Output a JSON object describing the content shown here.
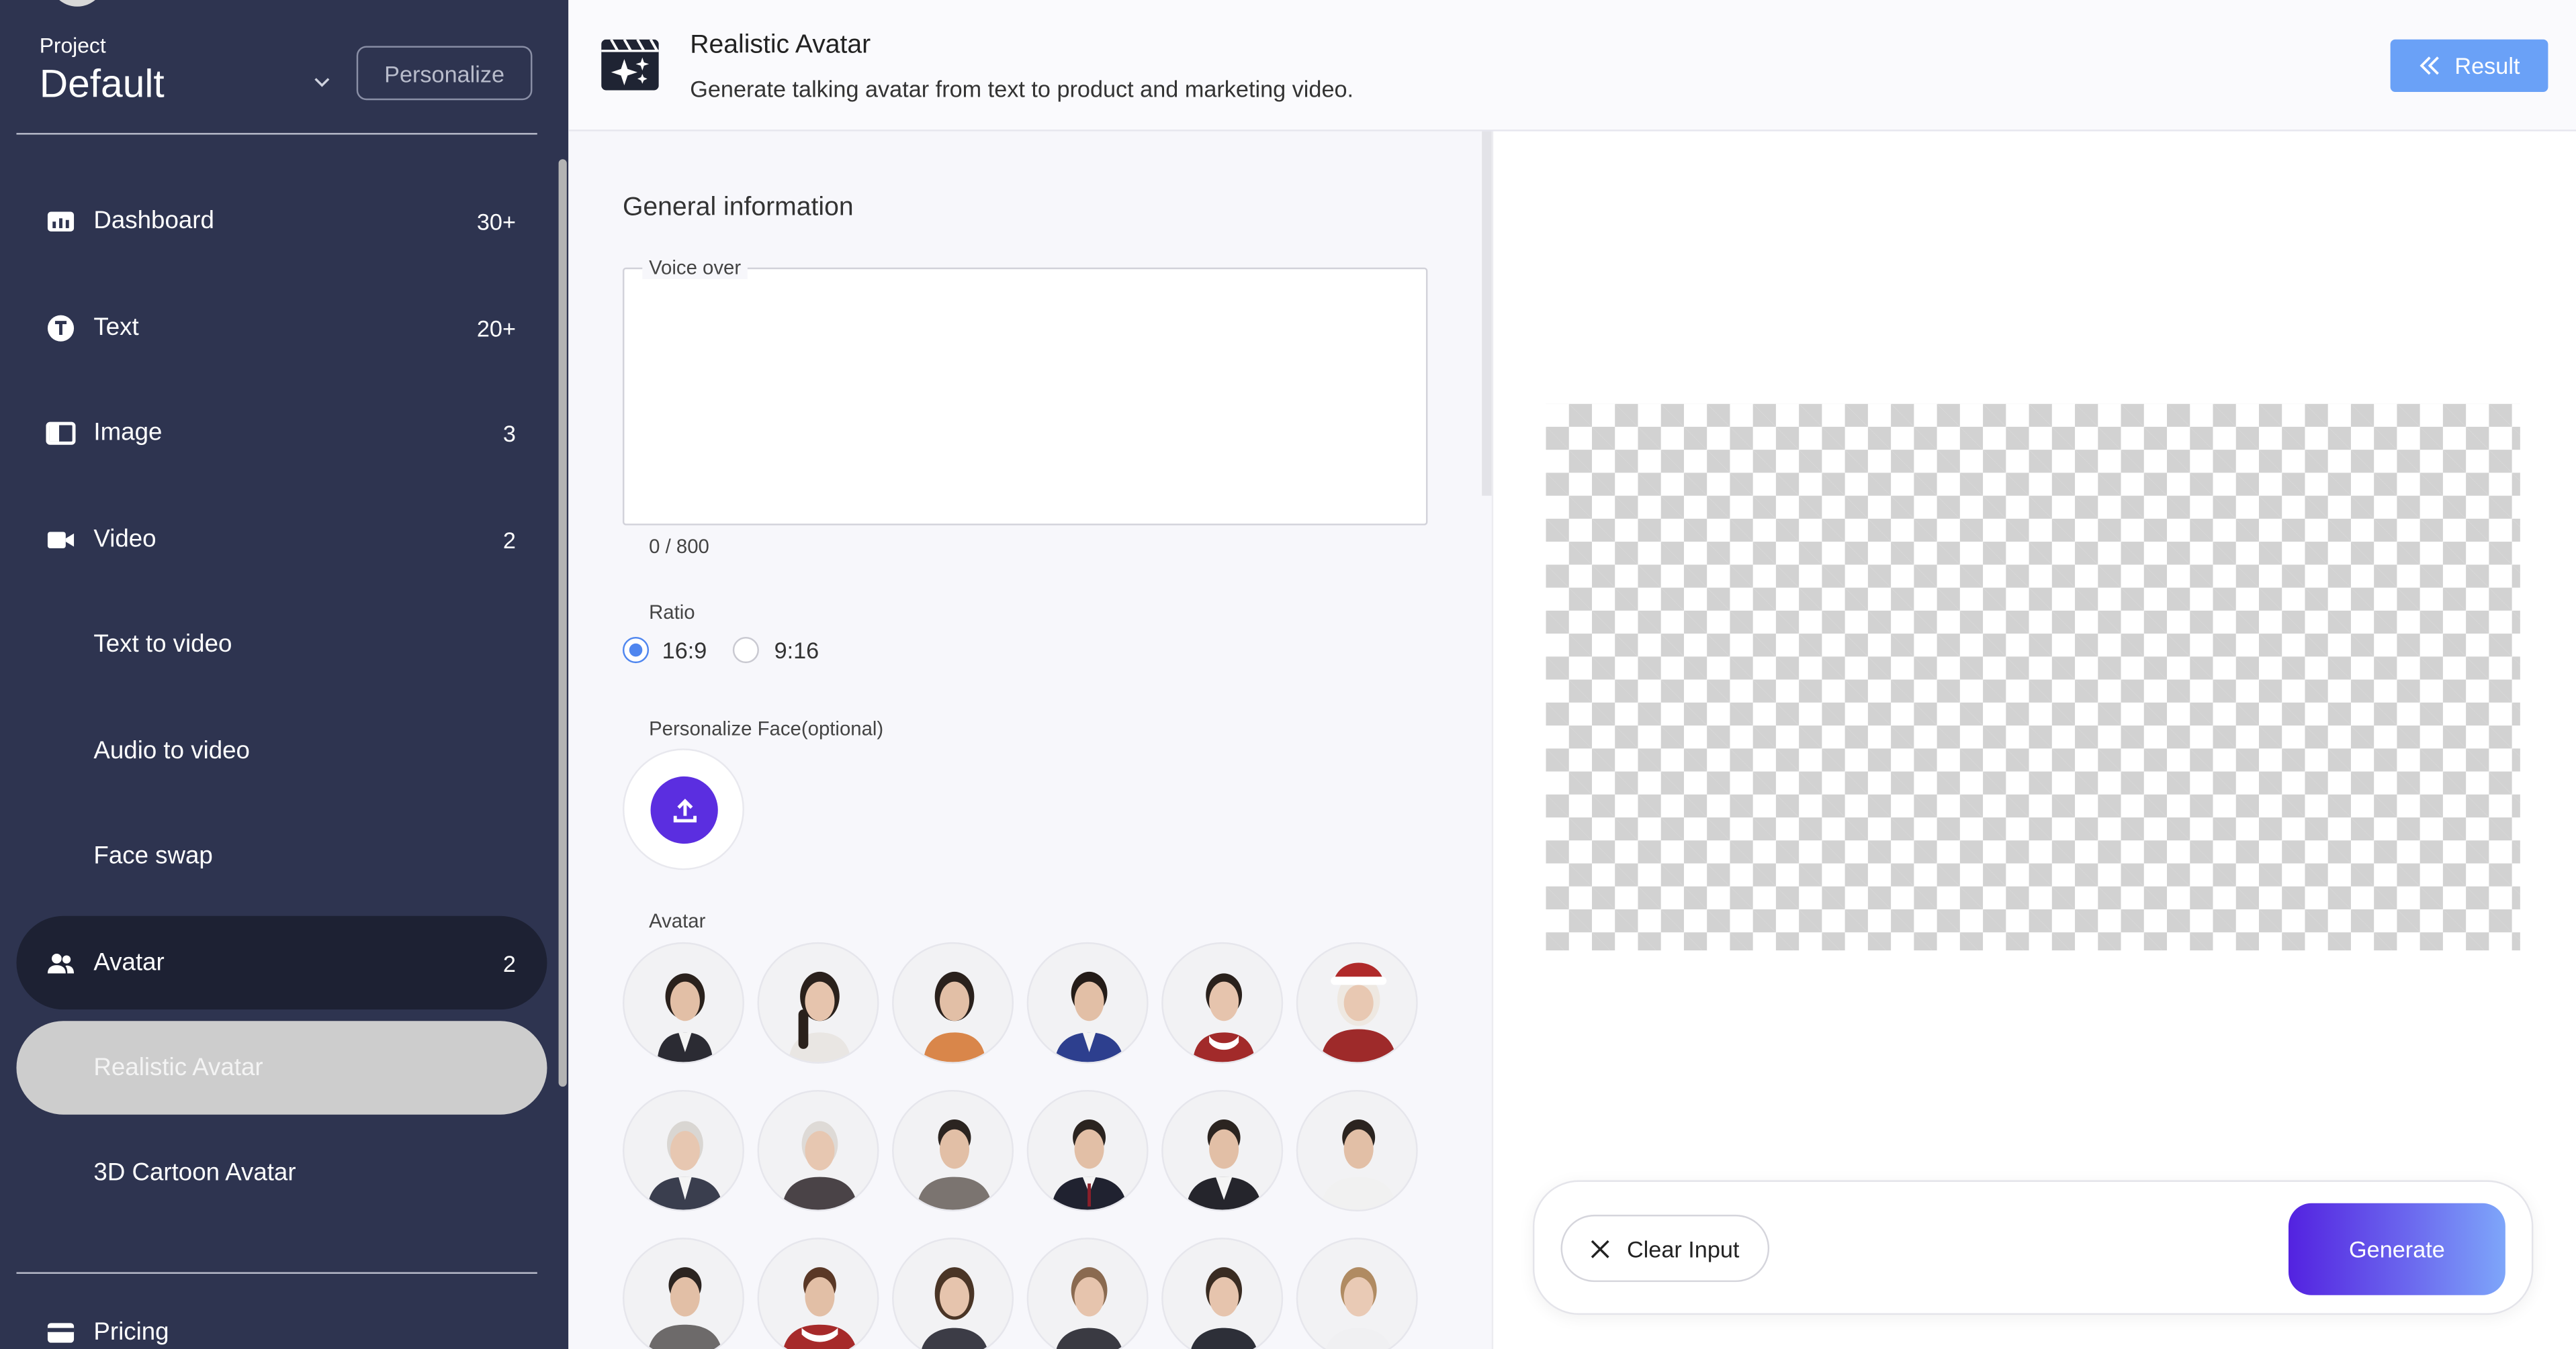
{
  "sidebar": {
    "project_label": "Project",
    "project_name": "Default",
    "personalize_label": "Personalize",
    "items": [
      {
        "label": "Dashboard",
        "count": "30+",
        "icon": "dashboard-icon"
      },
      {
        "label": "Text",
        "count": "20+",
        "icon": "text-icon"
      },
      {
        "label": "Image",
        "count": "3",
        "icon": "image-icon"
      },
      {
        "label": "Video",
        "count": "2",
        "icon": "video-icon"
      },
      {
        "label": "Text to video"
      },
      {
        "label": "Audio to video"
      },
      {
        "label": "Face swap"
      },
      {
        "label": "Avatar",
        "count": "2",
        "icon": "people-icon"
      },
      {
        "label": "Realistic Avatar"
      },
      {
        "label": "3D Cartoon Avatar"
      },
      {
        "label": "Pricing",
        "icon": "card-icon"
      }
    ]
  },
  "header": {
    "title": "Realistic Avatar",
    "subtitle": "Generate talking avatar from text to product and marketing video.",
    "result_label": "Result"
  },
  "form": {
    "section_title": "General information",
    "voice_over_label": "Voice over",
    "voice_over_value": "",
    "char_count": "0 / 800",
    "ratio_label": "Ratio",
    "ratio_options": [
      "16:9",
      "9:16"
    ],
    "ratio_selected": "16:9",
    "face_label": "Personalize Face(optional)",
    "avatar_label": "Avatar"
  },
  "actions": {
    "clear_label": "Clear Input",
    "generate_label": "Generate"
  },
  "colors": {
    "sidebar_bg": "#2e3450",
    "accent_blue": "#6aa1f7",
    "upload_purple": "#5b2ee0"
  }
}
